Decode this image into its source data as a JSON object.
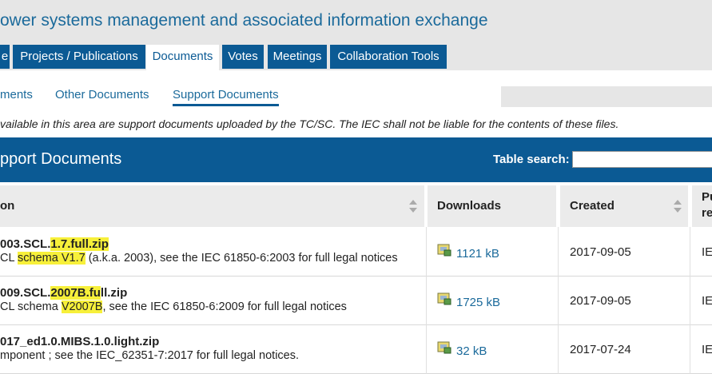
{
  "header": {
    "site_title": "ower systems management and associated information exchange",
    "nav": [
      {
        "label": "e"
      },
      {
        "label": "Projects / Publications"
      },
      {
        "label": "Documents"
      },
      {
        "label": "Votes"
      },
      {
        "label": "Meetings"
      },
      {
        "label": "Collaboration Tools"
      }
    ]
  },
  "subnav": [
    {
      "label": "ments"
    },
    {
      "label": "Other Documents"
    },
    {
      "label": "Support Documents"
    }
  ],
  "disclaimer": "vailable in this area are support documents uploaded by the TC/SC. The IEC shall not be liable for the contents of these files.",
  "table": {
    "title": "pport Documents",
    "search_label": "Table search:",
    "search_value": "",
    "columns": {
      "description": "on",
      "downloads": "Downloads",
      "created": "Created",
      "pub_line1": "Pu",
      "pub_line2": "re"
    },
    "rows": [
      {
        "name_pre": "003.SCL.",
        "name_hl": "1.7.full.zip",
        "desc_pre": "CL ",
        "desc_hl": "schema V1.7",
        "desc_post": " (a.k.a. 2003), see the IEC 61850-6:2003 for full legal notices",
        "size": "1121 kB",
        "created": "2017-09-05",
        "pub": "IE"
      },
      {
        "name_pre": "009.SCL.",
        "name_hl": "2007B.fu",
        "name_post": "ll.zip",
        "desc_pre": "CL schema ",
        "desc_hl": "V2007B",
        "desc_post": ", see the IEC 61850-6:2009 for full legal notices",
        "size": "1725 kB",
        "created": "2017-09-05",
        "pub": "IE"
      },
      {
        "name_pre": "017_ed1.0.MIBS.1.0.light.zip",
        "desc_pre": "mponent ; see the IEC_62351-7:2017 for full legal notices.",
        "size": "32 kB",
        "created": "2017-07-24",
        "pub": "IE"
      }
    ]
  },
  "colors": {
    "brand_blue": "#0b5a94",
    "link_blue": "#1b6a9b",
    "highlight": "#f7f03a"
  }
}
